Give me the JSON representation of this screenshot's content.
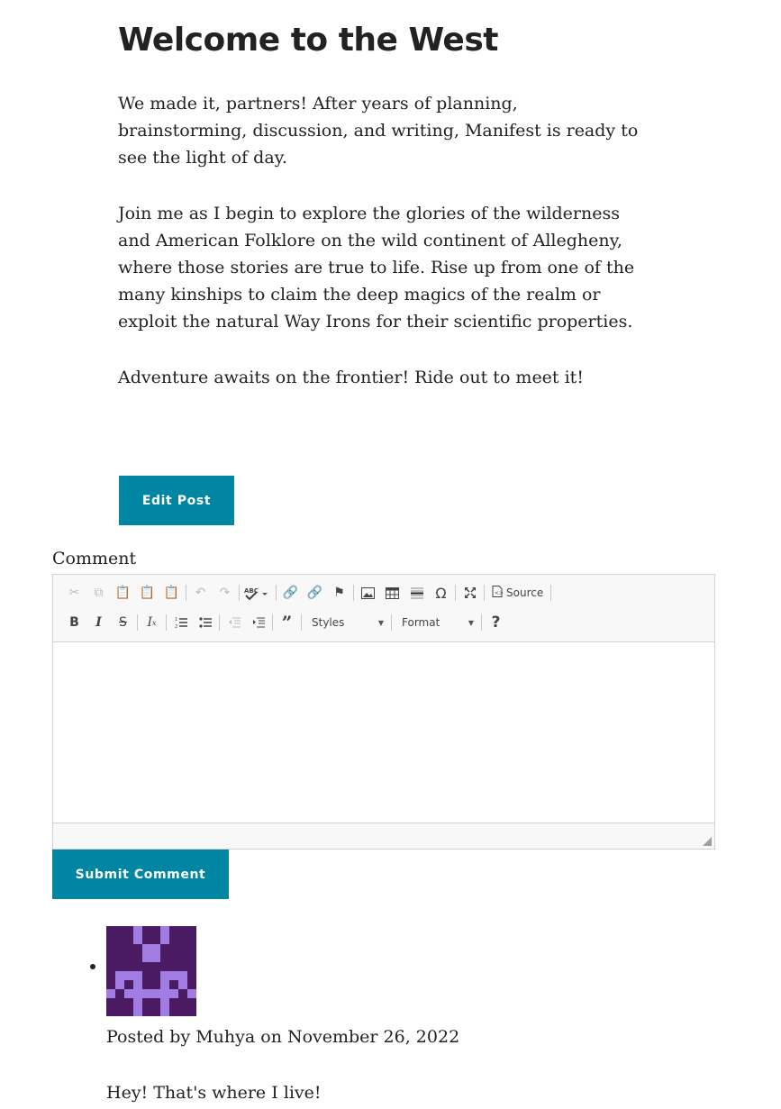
{
  "post": {
    "title": "Welcome to the West",
    "paragraphs": [
      "We made it, partners! After years of planning, brainstorming, discussion, and writing, Manifest is ready to see the light of day.",
      "Join me as I begin to explore the glories of the wilderness and American Folklore on the wild continent of Allegheny, where those stories are true to life. Rise up from one of the many kinships to claim the deep magics of the realm or exploit the natural Way Irons for their scientific properties.",
      "Adventure awaits on the frontier! Ride out to meet it!"
    ],
    "edit_label": "Edit Post"
  },
  "comment_form": {
    "label": "Comment",
    "toolbar": {
      "source_label": "Source",
      "styles_label": "Styles",
      "format_label": "Format",
      "help_label": "?"
    },
    "submit_label": "Submit Comment"
  },
  "comments": [
    {
      "meta": "Posted by Muhya on November 26, 2022",
      "text": "Hey! That's where I live!",
      "avatar_colors": {
        "background": "#4a1a63",
        "foreground": "#a07ce3"
      }
    }
  ],
  "colors": {
    "accent": "#0086a3"
  }
}
